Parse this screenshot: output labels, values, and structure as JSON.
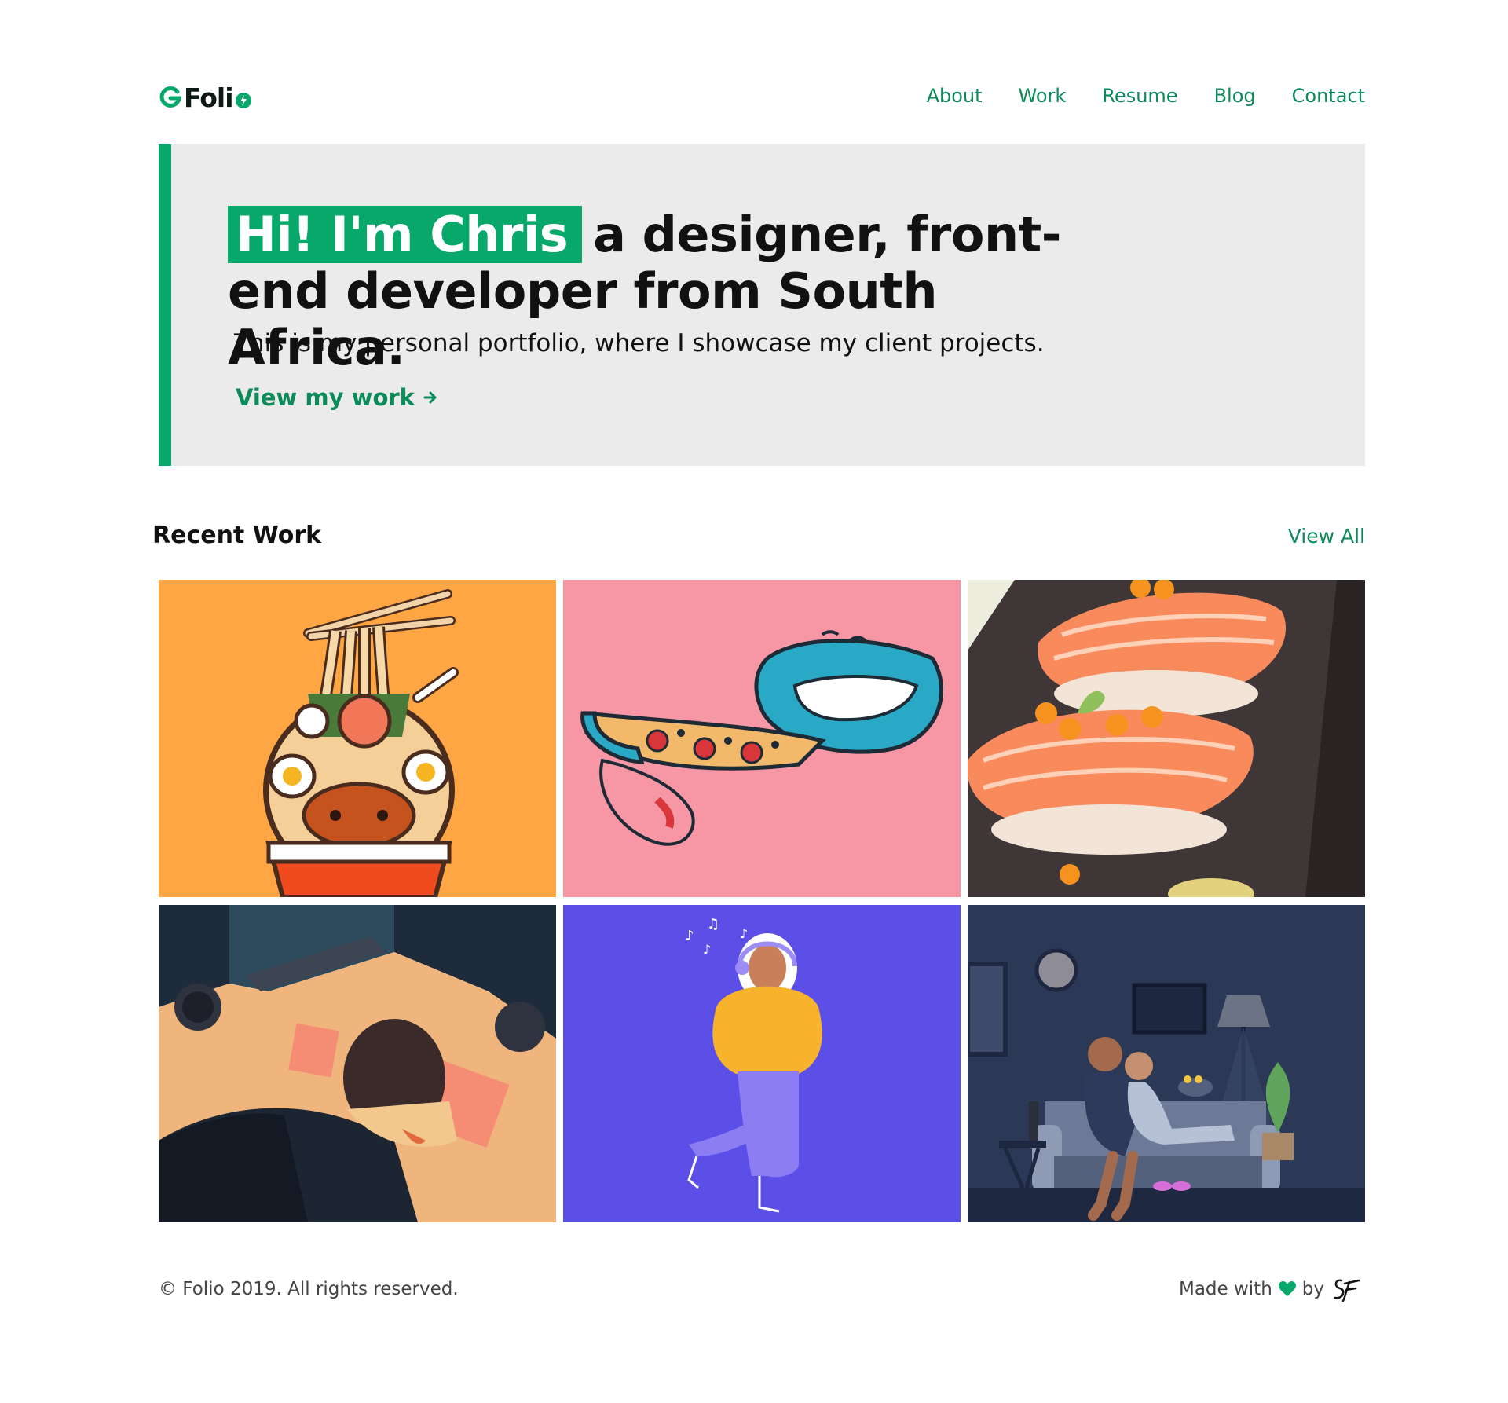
{
  "header": {
    "logo_text": "Foli",
    "nav": [
      "About",
      "Work",
      "Resume",
      "Blog",
      "Contact"
    ]
  },
  "hero": {
    "highlight": "Hi! I'm Chris",
    "title_rest": "a designer, front-end developer from South Africa.",
    "subtitle": "This is my personal portfolio, where I showcase my client projects.",
    "cta": "View my work"
  },
  "recent_work": {
    "title": "Recent Work",
    "view_all": "View All",
    "tiles": [
      {
        "name": "noodle-bowl-illustration",
        "bg": "#fda643"
      },
      {
        "name": "pizza-mouth-illustration",
        "bg": "#f797a5"
      },
      {
        "name": "salmon-sushi-illustration",
        "bg": "#3f3638"
      },
      {
        "name": "desk-worker-illustration",
        "bg": "#fde3c3"
      },
      {
        "name": "music-girl-illustration",
        "bg": "#5c4fe8"
      },
      {
        "name": "couple-couch-illustration",
        "bg": "#2b3856"
      }
    ]
  },
  "footer": {
    "copyright": "© Folio 2019. All rights reserved.",
    "made_with": "Made with",
    "by": "by"
  },
  "colors": {
    "accent": "#07a86a",
    "link": "#0b8a5a",
    "hero_bg": "#ebebeb"
  }
}
